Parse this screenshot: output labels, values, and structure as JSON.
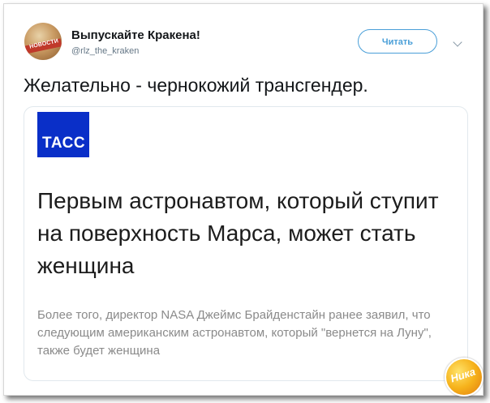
{
  "tweet": {
    "avatar_label": "НОВОСТИ",
    "display_name": "Выпускайте Кракена!",
    "handle": "@rlz_the_kraken",
    "follow_label": "Читать",
    "text": "Желательно - чернокожий трансгендер."
  },
  "card": {
    "logo_text": "ТАСС",
    "logo_color": "#0a2fc8",
    "headline": "Первым астронавтом, который ступит на поверхность Марса, может стать женщина",
    "lead": "Более того, директор NASA Джеймс Брайденстайн ранее заявил, что следующим американским астронавтом, который \"вернется на Луну\", также будет женщина"
  },
  "watermark": {
    "text": "Ника"
  },
  "colors": {
    "accent": "#4a9fd8",
    "text": "#14171a",
    "muted": "#657786"
  }
}
